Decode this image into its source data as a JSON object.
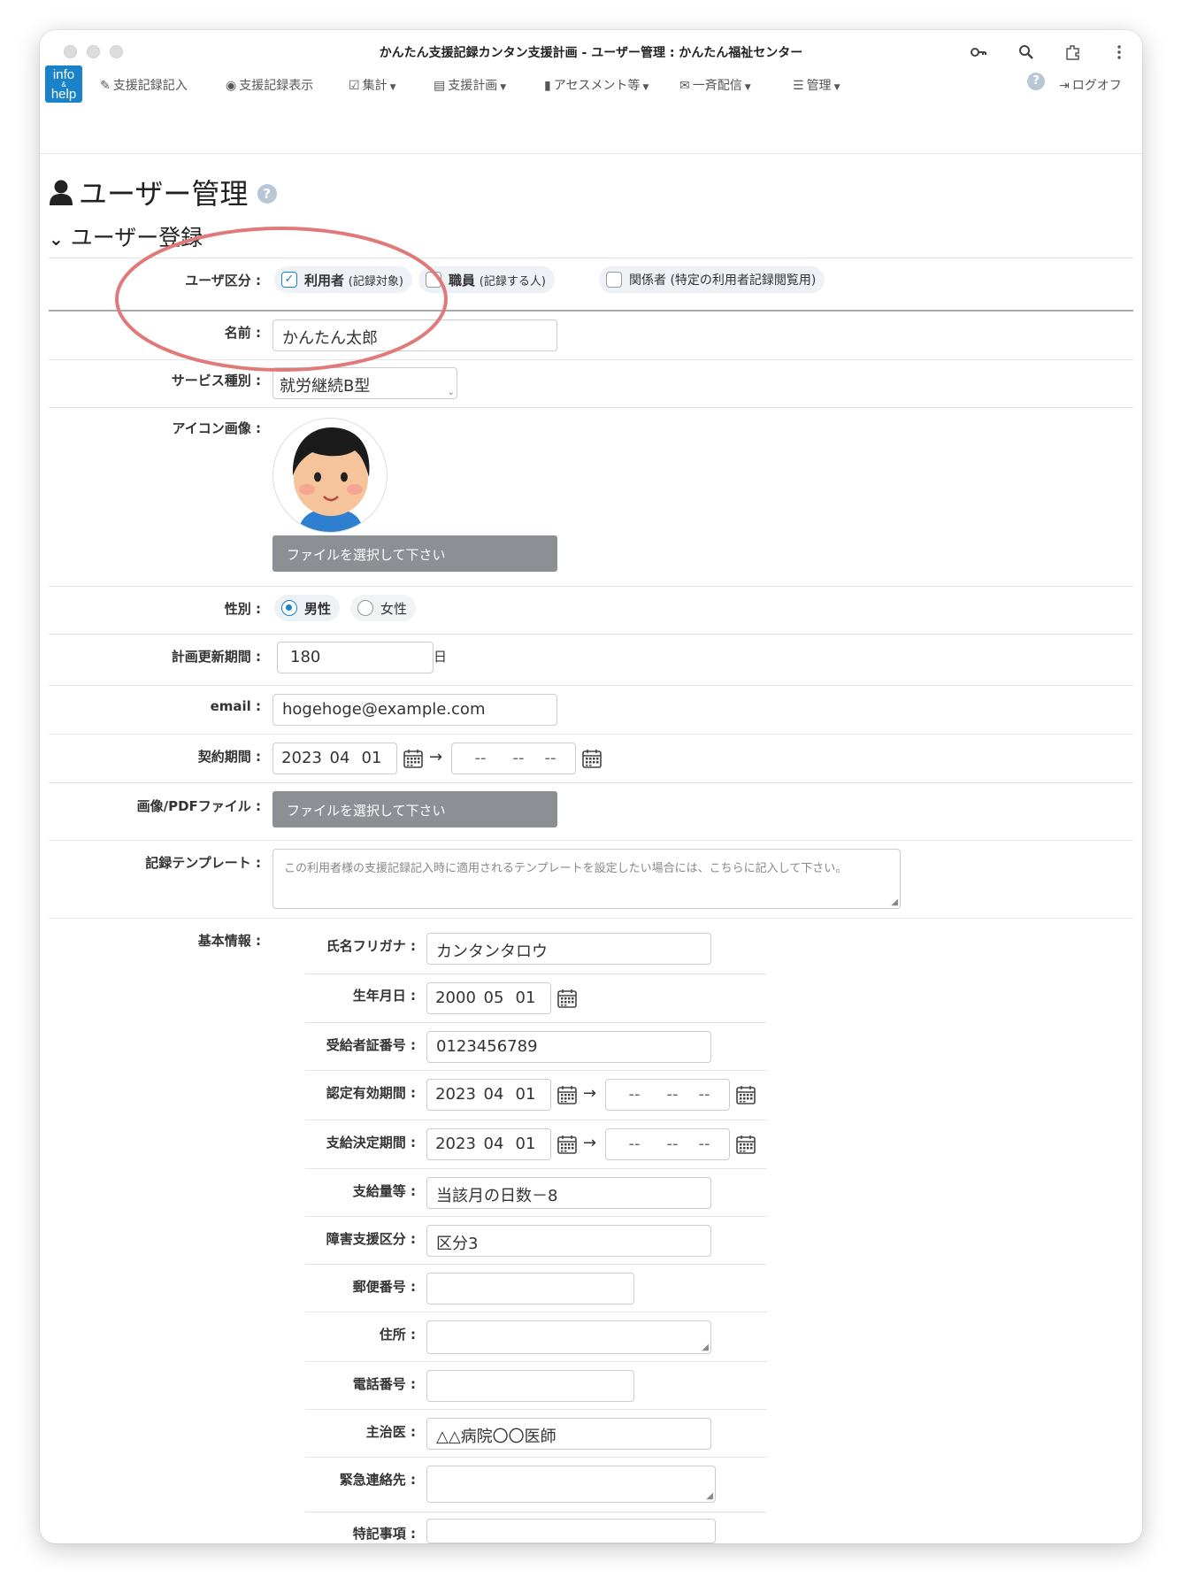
{
  "window": {
    "title": "かんたん支援記録カンタン支援計画 - ユーザー管理 : かんたん福祉センター"
  },
  "browser_icons": [
    "key-icon",
    "zoom-icon",
    "extension-icon",
    "more-icon"
  ],
  "logo": {
    "line1": "info",
    "line2": "&",
    "line3": "help"
  },
  "nav": {
    "items": [
      {
        "label": "支援記録記入",
        "icon": "pencil-icon"
      },
      {
        "label": "支援記録表示",
        "icon": "eye-icon"
      },
      {
        "label": "集計",
        "icon": "check-square-icon"
      },
      {
        "label": "支援計画",
        "icon": "list-alt-icon"
      },
      {
        "label": "アセスメント等",
        "icon": "file-icon"
      },
      {
        "label": "一斉配信",
        "icon": "envelope-icon"
      },
      {
        "label": "管理",
        "icon": "list-icon"
      }
    ],
    "help_icon": "question-circle-icon",
    "logout": "ログオフ"
  },
  "page": {
    "title": "ユーザー管理",
    "section": "ユーザー登録"
  },
  "form": {
    "user_type": {
      "label": "ユーザ区分 :",
      "options": [
        {
          "main": "利用者",
          "sub": "(記録対象)",
          "checked": true
        },
        {
          "main": "職員",
          "sub": "(記録する人)",
          "checked": false
        },
        {
          "main": "関係者 (特定の利用者記録閲覧用)",
          "sub": "",
          "checked": false
        }
      ]
    },
    "name": {
      "label": "名前 :",
      "value": "かんたん太郎"
    },
    "service": {
      "label": "サービス種別 :",
      "value": "就労継続B型"
    },
    "icon_image": {
      "label": "アイコン画像 :",
      "file_button": "ファイルを選択して下さい"
    },
    "gender": {
      "label": "性別 :",
      "options": [
        {
          "label": "男性",
          "checked": true
        },
        {
          "label": "女性",
          "checked": false
        }
      ]
    },
    "plan_period": {
      "label": "計画更新期間 :",
      "value": "180",
      "unit": "日"
    },
    "email": {
      "label": "email :",
      "value": "hogehoge@example.com"
    },
    "contract": {
      "label": "契約期間 :",
      "start": {
        "y": "2023",
        "m": "04",
        "d": "01"
      },
      "end": {
        "y": "--",
        "m": "--",
        "d": "--"
      },
      "arrow": "→"
    },
    "pdf_file": {
      "label": "画像/PDFファイル :",
      "file_button": "ファイルを選択して下さい"
    },
    "template": {
      "label": "記録テンプレート :",
      "placeholder": "この利用者様の支援記録記入時に適用されるテンプレートを設定したい場合には、こちらに記入して下さい。"
    },
    "basic_info": {
      "label": "基本情報 :",
      "furigana": {
        "label": "氏名フリガナ :",
        "value": "カンタンタロウ"
      },
      "birthday": {
        "label": "生年月日 :",
        "y": "2000",
        "m": "05",
        "d": "01"
      },
      "recipient_no": {
        "label": "受給者証番号 :",
        "value": "0123456789"
      },
      "cert_period": {
        "label": "認定有効期間 :",
        "start": {
          "y": "2023",
          "m": "04",
          "d": "01"
        },
        "end": {
          "y": "--",
          "m": "--",
          "d": "--"
        },
        "arrow": "→"
      },
      "decision_period": {
        "label": "支給決定期間 :",
        "start": {
          "y": "2023",
          "m": "04",
          "d": "01"
        },
        "end": {
          "y": "--",
          "m": "--",
          "d": "--"
        },
        "arrow": "→"
      },
      "amount": {
        "label": "支給量等 :",
        "value": "当該月の日数－8"
      },
      "disability_class": {
        "label": "障害支援区分 :",
        "value": "区分3"
      },
      "postal": {
        "label": "郵便番号 :",
        "value": ""
      },
      "address": {
        "label": "住所 :",
        "value": ""
      },
      "phone": {
        "label": "電話番号 :",
        "value": ""
      },
      "doctor": {
        "label": "主治医 :",
        "value": "△△病院〇〇医師"
      },
      "emergency": {
        "label": "緊急連絡先 :",
        "value": ""
      },
      "notes": {
        "label": "特記事項 :",
        "value": ""
      }
    }
  },
  "colors": {
    "accent": "#1a82c9",
    "annotation": "#e07a7a",
    "file_button": "#8c8f94"
  }
}
